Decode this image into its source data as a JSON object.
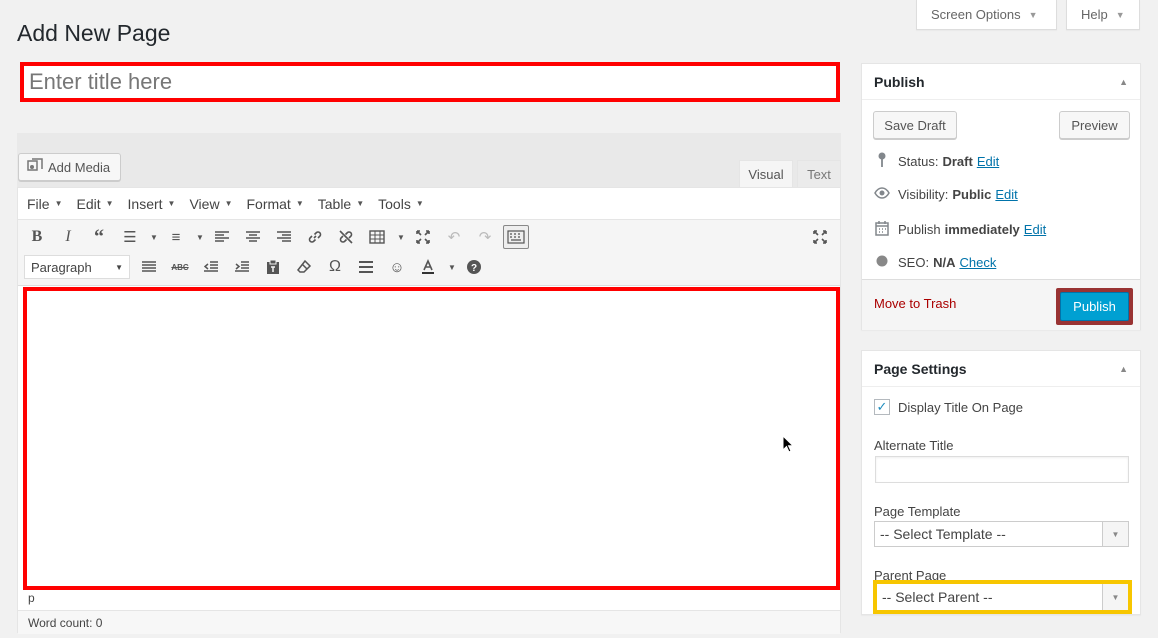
{
  "header": {
    "title": "Add New Page",
    "screen_options": "Screen Options",
    "help": "Help"
  },
  "title_field": {
    "placeholder": "Enter title here",
    "value": ""
  },
  "editor": {
    "add_media": "Add Media",
    "tabs": {
      "visual": "Visual",
      "text": "Text"
    },
    "menu": [
      "File",
      "Edit",
      "Insert",
      "View",
      "Format",
      "Table",
      "Tools"
    ],
    "format_select": "Paragraph",
    "path": "p",
    "word_count": "Word count: 0",
    "icons": [
      "bold-icon",
      "italic-icon",
      "blockquote-icon",
      "bullet-list-icon",
      "numbered-list-icon",
      "align-left-icon",
      "align-center-icon",
      "align-right-icon",
      "link-icon",
      "unlink-icon",
      "table-icon",
      "distraction-free-icon",
      "undo-icon",
      "redo-icon",
      "toolbar-toggle-icon",
      "fullscreen-icon",
      "justify-icon",
      "strikethrough-icon",
      "outdent-icon",
      "indent-icon",
      "paste-text-icon",
      "clear-formatting-icon",
      "special-character-icon",
      "horizontal-line-icon",
      "emoticons-icon",
      "text-color-icon",
      "help-icon"
    ]
  },
  "publish": {
    "title": "Publish",
    "save_draft": "Save Draft",
    "preview": "Preview",
    "status_label": "Status:",
    "status_value": "Draft",
    "visibility_label": "Visibility:",
    "visibility_value": "Public",
    "publish_label": "Publish",
    "publish_value": "immediately",
    "seo_label": "SEO:",
    "seo_value": "N/A",
    "edit": "Edit",
    "check": "Check",
    "move_to_trash": "Move to Trash",
    "publish_button": "Publish",
    "colors": {
      "publish_button": "#00a0d2",
      "publish_highlight": "#993333",
      "trash": "#aa0000",
      "link": "#0073aa"
    }
  },
  "page_settings": {
    "title": "Page Settings",
    "display_title": "Display Title On Page",
    "display_title_checked": true,
    "alternate_title_label": "Alternate Title",
    "alternate_title_value": "",
    "page_template_label": "Page Template",
    "page_template_value": "-- Select Template --",
    "parent_page_label": "Parent Page",
    "parent_page_value": "-- Select Parent --"
  },
  "highlights": {
    "title_and_content": "#ff0000",
    "parent_page": "#f7c600"
  }
}
